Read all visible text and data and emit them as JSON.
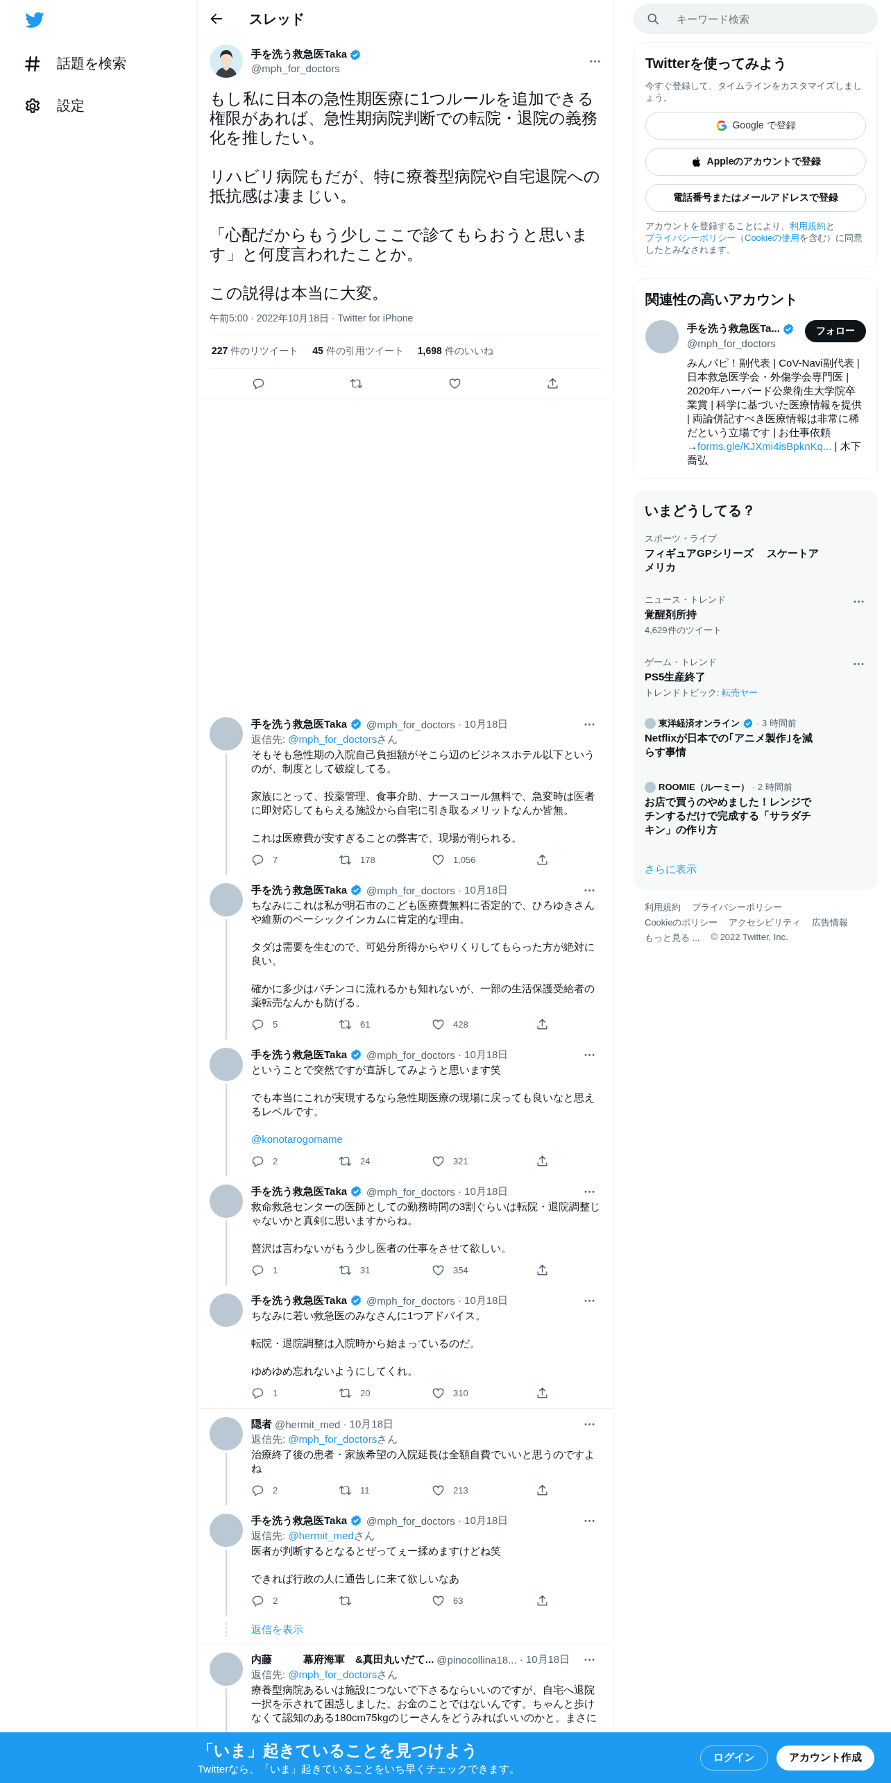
{
  "nav": {
    "items": [
      {
        "kind": "hashtag",
        "label": "話題を検索"
      },
      {
        "kind": "gear",
        "label": "設定"
      }
    ]
  },
  "header": {
    "title": "スレッド"
  },
  "main_tweet": {
    "name": "手を洗う救急医Taka",
    "verified": true,
    "handle": "@mph_for_doctors",
    "paragraphs": [
      "もし私に日本の急性期医療に1つルールを追加できる権限があれば、急性期病院判断での転院・退院の義務化を推したい。",
      "リハビリ病院もだが、特に療養型病院や自宅退院への抵抗感は凄まじい。",
      "「心配だからもう少しここで診てもらおうと思います」と何度言われたことか。",
      "この説得は本当に大変。"
    ],
    "meta": "午前5:00 · 2022年10月18日 · Twitter for iPhone",
    "stats": [
      "**227** 件のリツイート",
      "**45** 件の引用ツイート",
      "**1,698** 件のいいね"
    ]
  },
  "conversations": [
    {
      "tweets": [
        {
          "name": "手を洗う救急医Taka",
          "verified": true,
          "handle": "@mph_for_doctors",
          "date": "· 10月18日",
          "connector": true,
          "reply_to": {
            "prefix": "返信先:",
            "handle": "@mph_for_doctors",
            "suffix": "さん"
          },
          "paragraphs": [
            "そもそも急性期の入院自己負担額がそこら辺のビジネスホテル以下というのが、制度として破綻してる。",
            "家族にとって、投薬管理、食事介助、ナースコール無料で、急変時は医者に即対応してもらえる施設から自宅に引き取るメリットなんか皆無。",
            "これは医療費が安すぎることの弊害で、現場が削られる。"
          ],
          "actions": {
            "reply": "7",
            "retweet": "178",
            "like": "1,056"
          }
        },
        {
          "name": "手を洗う救急医Taka",
          "verified": true,
          "handle": "@mph_for_doctors",
          "date": "· 10月18日",
          "connector": true,
          "paragraphs": [
            "ちなみにこれは私が明石市のこども医療費無料に否定的で、ひろゆきさんや維新のベーシックインカムに肯定的な理由。",
            "タダは需要を生むので、可処分所得からやりくりしてもらった方が絶対に良い。",
            "確かに多少はパチンコに流れるかも知れないが、一部の生活保護受給者の薬転売なんかも防げる。"
          ],
          "actions": {
            "reply": "5",
            "retweet": "61",
            "like": "428"
          }
        },
        {
          "name": "手を洗う救急医Taka",
          "verified": true,
          "handle": "@mph_for_doctors",
          "date": "· 10月18日",
          "connector": true,
          "paragraphs": [
            "ということで突然ですが直訴してみようと思います笑",
            "でも本当にこれが実現するなら急性期医療の現場に戻っても良いなと思えるレベルです。"
          ],
          "mention": "@konotarogomame",
          "actions": {
            "reply": "2",
            "retweet": "24",
            "like": "321"
          }
        },
        {
          "name": "手を洗う救急医Taka",
          "verified": true,
          "handle": "@mph_for_doctors",
          "date": "· 10月18日",
          "connector": true,
          "paragraphs": [
            "救命救急センターの医師としての勤務時間の3割ぐらいは転院・退院調整じゃないかと真剣に思いますからね。",
            "贅沢は言わないがもう少し医者の仕事をさせて欲しい。"
          ],
          "actions": {
            "reply": "1",
            "retweet": "31",
            "like": "354"
          }
        },
        {
          "name": "手を洗う救急医Taka",
          "verified": true,
          "handle": "@mph_for_doctors",
          "date": "· 10月18日",
          "connector": false,
          "paragraphs": [
            "ちなみに若い救急医のみなさんに1つアドバイス。",
            "転院・退院調整は入院時から始まっているのだ。",
            "ゆめゆめ忘れないようにしてくれ。"
          ],
          "actions": {
            "reply": "1",
            "retweet": "20",
            "like": "310"
          }
        }
      ]
    },
    {
      "tweets": [
        {
          "name": "隠者",
          "verified": false,
          "handle": "@hermit_med",
          "date": "· 10月18日",
          "connector": true,
          "reply_to": {
            "prefix": "返信先:",
            "handle": "@mph_for_doctors",
            "suffix": "さん"
          },
          "paragraphs": [
            "治療終了後の患者・家族希望の入院延長は全額自費でいいと思うのですよね"
          ],
          "actions": {
            "reply": "2",
            "retweet": "11",
            "like": "213"
          }
        },
        {
          "name": "手を洗う救急医Taka",
          "verified": true,
          "handle": "@mph_for_doctors",
          "date": "· 10月18日",
          "connector": true,
          "reply_to": {
            "prefix": "返信先:",
            "handle": "@hermit_med",
            "suffix": "さん"
          },
          "paragraphs": [
            "医者が判断するとなるとぜってぇー揉めますけどね笑",
            "できれば行政の人に通告しに来て欲しいなあ"
          ],
          "actions": {
            "reply": "2",
            "like": "63"
          }
        }
      ],
      "show_more": "返信を表示"
    },
    {
      "tweets": [
        {
          "name": "内藤　　　幕府海軍　&真田丸いだて...",
          "verified": false,
          "handle": "@pinocollina18...",
          "date": "· 10月18日",
          "connector": true,
          "reply_to": {
            "prefix": "返信先:",
            "handle": "@mph_for_doctors",
            "suffix": "さん"
          },
          "paragraphs": [
            "療養型病院あるいは施設につないで下さるならいいのですが、自宅へ退院一択を示されて困惑しました。お金のことではないんです。ちゃんと歩けなくて認知のある180cm75kgのじーさんをどうみればいいのかと。まさに"
          ]
        }
      ]
    }
  ],
  "sidebar": {
    "search": {
      "placeholder": "キーワード検索"
    },
    "signup": {
      "title": "Twitterを使ってみよう",
      "subtitle": "今すぐ登録して、タイムラインをカスタマイズしましょう。",
      "buttons": [
        {
          "kind": "google",
          "label": "Google で登録"
        },
        {
          "kind": "apple",
          "label": "Appleのアカウントで登録"
        },
        {
          "kind": "plain",
          "label": "電話番号またはメールアドレスで登録"
        }
      ],
      "legal": [
        {
          "kind": "text",
          "text": "アカウントを登録することにより、"
        },
        {
          "kind": "link",
          "text": "利用規約"
        },
        {
          "kind": "text",
          "text": "と"
        },
        {
          "kind": "link",
          "text": "プライバシーポリシー"
        },
        {
          "kind": "text",
          "text": "（"
        },
        {
          "kind": "link",
          "text": "Cookieの使用"
        },
        {
          "kind": "text",
          "text": "を含む）に同意したとみなされます。"
        }
      ]
    },
    "related": {
      "title": "関連性の高いアカウント",
      "name": "手を洗う救急医Ta...",
      "verified": true,
      "handle": "@mph_for_doctors",
      "follow": "フォロー",
      "bio": "みんパピ！副代表 | CoV-Navi副代表 | 日本救急医学会・外傷学会専門医 | 2020年ハーバード公衆衛生大学院卒業賞 | 科学に基づいた医療情報を提供 | 両論併記すべき医療情報は非常に稀だという立場です | お仕事依頼 →",
      "bio_link": "forms.gle/KJXmi4isBpknKq...",
      "bio_after": " | 木下喬弘"
    },
    "trends": {
      "title": "いまどうしてる？",
      "items": [
        {
          "kind": "trend",
          "category": "スポーツ・ライブ",
          "title": "フィギュアGPシリーズ　 スケートアメリカ",
          "more": false
        },
        {
          "kind": "trend",
          "category": "ニュース・トレンド",
          "title": "覚醒剤所持",
          "subline": "4,629件のツイート",
          "more": true
        },
        {
          "kind": "trend",
          "category": "ゲーム・トレンド",
          "title": "PS5生産終了",
          "subline": "トレンドトピック: ",
          "subline_link": "転売ヤー",
          "more": true
        },
        {
          "kind": "news",
          "source": "東洋経済オンライン",
          "verified": true,
          "time": "· 3 時間前",
          "title": "Netflixが日本での｢アニメ製作｣を減らす事情"
        },
        {
          "kind": "news",
          "source": "ROOMIE（ルーミー）",
          "verified": false,
          "time": "· 2 時間前",
          "title": "お店で買うのやめました！レンジでチンするだけで完成する「サラダチキン」の作り方"
        }
      ],
      "show_more": "さらに表示"
    },
    "footer": {
      "links": [
        "利用規約",
        "プライバシーポリシー",
        "Cookieのポリシー",
        "アクセシビリティ",
        "広告情報",
        "もっと見る ..."
      ],
      "copyright": "© 2022 Twitter, Inc."
    }
  },
  "banner": {
    "title": "「いま」起きていることを見つけよう",
    "subtitle": "Twitterなら、「いま」起きていることをいち早くチェックできます。",
    "login": "ログイン",
    "signup": "アカウント作成"
  }
}
